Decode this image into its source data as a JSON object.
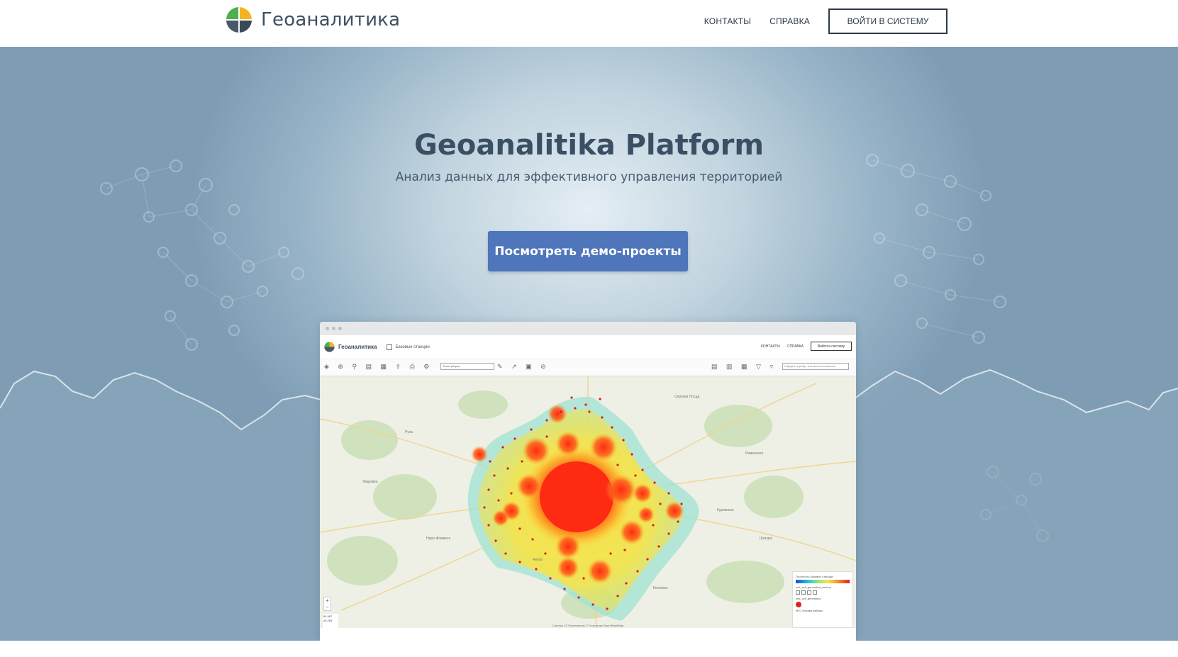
{
  "header": {
    "brand_name": "Геоаналитика",
    "nav": {
      "contacts_label": "КОНТАКТЫ",
      "help_label": "СПРАВКА",
      "login_label": "ВОЙТИ В СИСТЕМУ"
    }
  },
  "hero": {
    "title": "Geoanalitika Platform",
    "subtitle": "Анализ данных для эффективного управления территорией",
    "demo_button_label": "Посмотреть демо-проекты"
  },
  "mockup": {
    "brand_name": "Геоаналитика",
    "layer_name": "Базовые станции",
    "nav": {
      "contacts_label": "КОНТАКТЫ",
      "help_label": "СПРАВКА",
      "login_label": "Войти в систему"
    },
    "toolbar": {
      "select_value": "Точки уборки",
      "search_placeholder": "Найдите атрибут или местоположение"
    },
    "legend": {
      "title": "Плотность базовых станций",
      "layer1": "mts_cell_generated_sectors",
      "layer2": "mts_cell_generated",
      "layer3": "МГС Москва районы"
    },
    "coords": {
      "lat": "54.987",
      "lon": "40.259"
    },
    "attribution": "Спутник | © Ростелеком | © Участники OpenStreetMap"
  },
  "colors": {
    "brand_text": "#3d4f63",
    "demo_button": "#4f75bb",
    "heat_core": "#e8231a"
  }
}
